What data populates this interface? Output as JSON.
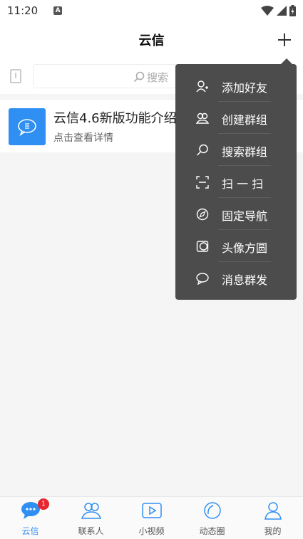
{
  "status_bar": {
    "time": "11:20",
    "a_icon": "A"
  },
  "header": {
    "title": "云信"
  },
  "search": {
    "placeholder": "搜索"
  },
  "conversation": {
    "title": "云信4.6新版功能介绍",
    "subtitle": "点击查看详情"
  },
  "popup_menu": {
    "items": [
      {
        "label": "添加好友",
        "icon": "add-friend-icon"
      },
      {
        "label": "创建群组",
        "icon": "create-group-icon"
      },
      {
        "label": "搜索群组",
        "icon": "search-icon"
      },
      {
        "label": "扫 一 扫",
        "icon": "scan-icon"
      },
      {
        "label": "固定导航",
        "icon": "compass-icon"
      },
      {
        "label": "头像方圆",
        "icon": "avatar-shape-icon"
      },
      {
        "label": "消息群发",
        "icon": "chat-bubble-icon"
      }
    ]
  },
  "bottom_nav": {
    "items": [
      {
        "label": "云信",
        "icon": "chat-icon",
        "active": true,
        "badge": "1"
      },
      {
        "label": "联系人",
        "icon": "contacts-icon"
      },
      {
        "label": "小视频",
        "icon": "video-icon"
      },
      {
        "label": "动态圈",
        "icon": "moments-icon"
      },
      {
        "label": "我的",
        "icon": "profile-icon"
      }
    ]
  },
  "colors": {
    "accent": "#2f8ff2",
    "menu_bg": "#4c4c4c",
    "badge": "#e8262d"
  }
}
